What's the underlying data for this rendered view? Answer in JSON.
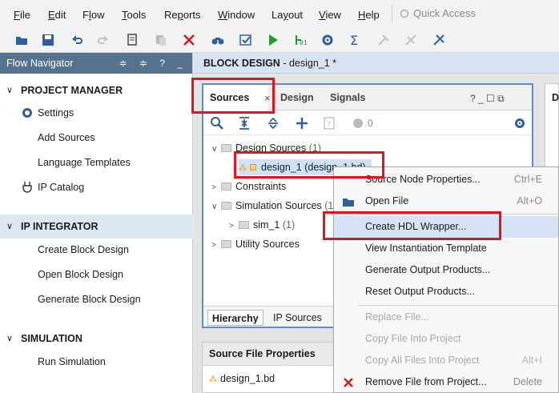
{
  "menubar": {
    "items": [
      {
        "label": "File",
        "u": "F",
        "rest": "ile"
      },
      {
        "label": "Edit",
        "u": "E",
        "rest": "dit"
      },
      {
        "label": "Flow",
        "u": "",
        "pre": "F",
        "u2": "l",
        "rest": "ow"
      },
      {
        "label": "Tools",
        "u": "T",
        "rest": "ools"
      },
      {
        "label": "Reports",
        "u": "",
        "pre": "Re",
        "u2": "p",
        "rest": "orts"
      },
      {
        "label": "Window",
        "u": "W",
        "rest": "indow"
      },
      {
        "label": "Layout",
        "u": "",
        "pre": "La",
        "u2": "y",
        "rest": "out"
      },
      {
        "label": "View",
        "u": "V",
        "rest": "iew"
      },
      {
        "label": "Help",
        "u": "H",
        "rest": "elp"
      }
    ],
    "quick_access_placeholder": "Quick Access"
  },
  "flow_navigator": {
    "title": "Flow Navigator",
    "header_icons": "≑ ≑ ? _",
    "sections": [
      {
        "title": "PROJECT MANAGER",
        "items": [
          "Settings",
          "Add Sources",
          "Language Templates",
          "IP Catalog"
        ]
      },
      {
        "title": "IP INTEGRATOR",
        "items": [
          "Create Block Design",
          "Open Block Design",
          "Generate Block Design"
        ]
      },
      {
        "title": "SIMULATION",
        "items": [
          "Run Simulation"
        ]
      }
    ]
  },
  "block_design": {
    "label": "BLOCK DESIGN",
    "name": " - design_1 *"
  },
  "sources_panel": {
    "tabs": [
      "Sources",
      "Design",
      "Signals"
    ],
    "controls": "?  _  ☐  ⧉",
    "warning_count": "0",
    "tree": {
      "design_sources": "Design Sources",
      "design_sources_count": "(1)",
      "design_file": "design_1 (design_1.bd)",
      "constraints": "Constraints",
      "simulation_sources": "Simulation Sources",
      "simulation_sources_count": "(1",
      "sim_1": "sim_1",
      "sim_1_count": "(1)",
      "utility_sources": "Utility Sources"
    },
    "bottom_tabs": [
      "Hierarchy",
      "IP Sources"
    ]
  },
  "source_file_properties": {
    "title": "Source File Properties",
    "file": "design_1.bd"
  },
  "right_panel": {
    "label": "D"
  },
  "context_menu": {
    "items": [
      {
        "label": "Source Node Properties...",
        "shortcut": "Ctrl+E",
        "disabled": false
      },
      {
        "label": "Open File",
        "shortcut": "Alt+O",
        "disabled": false
      },
      {
        "label": "Create HDL Wrapper...",
        "shortcut": "",
        "disabled": false
      },
      {
        "label": "View Instantiation Template",
        "shortcut": "",
        "disabled": false
      },
      {
        "label": "Generate Output Products...",
        "shortcut": "",
        "disabled": false
      },
      {
        "label": "Reset Output Products...",
        "shortcut": "",
        "disabled": false
      },
      {
        "label": "Replace File...",
        "shortcut": "",
        "disabled": true
      },
      {
        "label": "Copy File Into Project",
        "shortcut": "",
        "disabled": true
      },
      {
        "label": "Copy All Files Into Project",
        "shortcut": "Alt+I",
        "disabled": true
      },
      {
        "label": "Remove File from Project...",
        "shortcut": "Delete",
        "disabled": false
      }
    ]
  },
  "colors": {
    "highlight_red": "#e0141e",
    "nav_header": "#55728f",
    "panel_border": "#5b8dc7"
  }
}
